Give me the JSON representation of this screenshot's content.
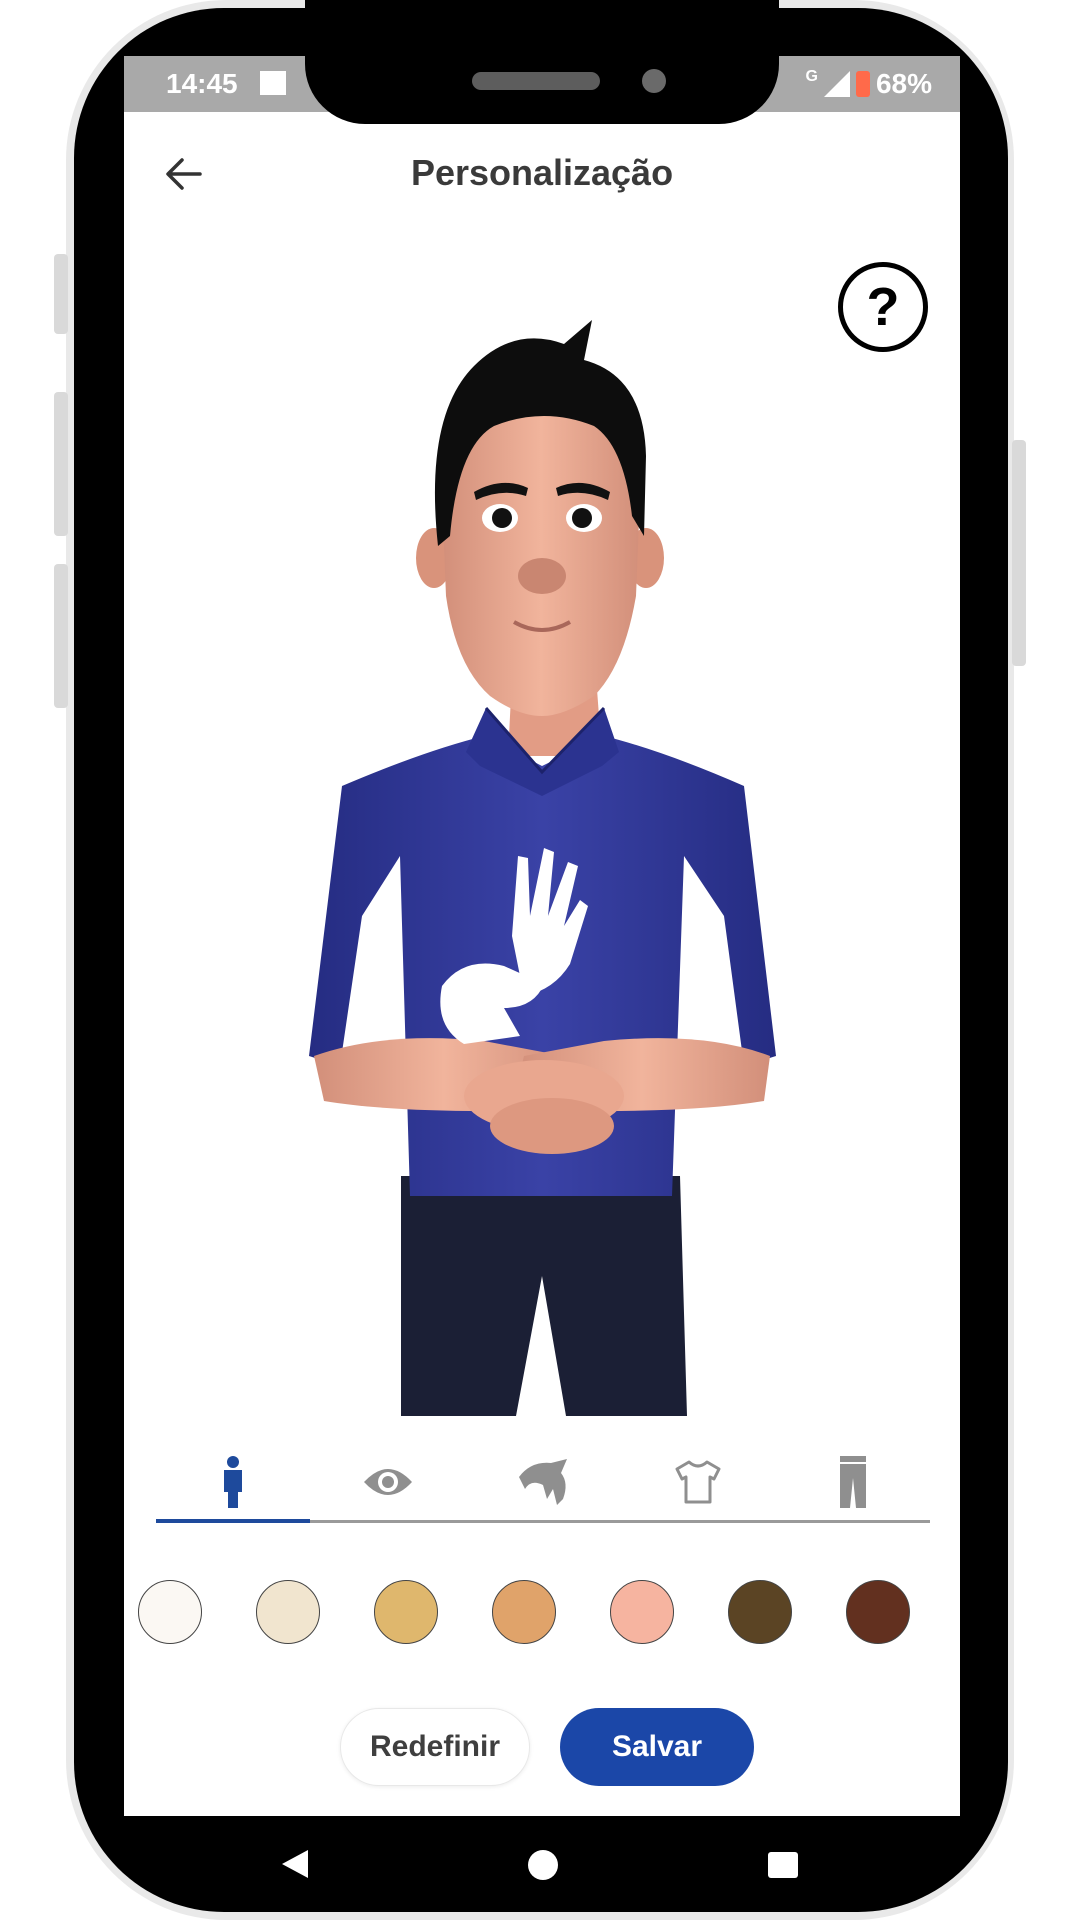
{
  "status_bar": {
    "time": "14:45",
    "network": "G",
    "battery": "68%",
    "icons": [
      "image-notification-icon",
      "signal-icon",
      "battery-icon"
    ]
  },
  "header": {
    "title": "Personalização",
    "back_icon": "arrow-left-icon"
  },
  "help": {
    "label": "?",
    "icon": "help-icon"
  },
  "tabs": [
    {
      "icon": "person-icon",
      "active": true,
      "color": "#1e4a9c"
    },
    {
      "icon": "eye-icon",
      "active": false,
      "color": "#8f8f8f"
    },
    {
      "icon": "hair-icon",
      "active": false,
      "color": "#8f8f8f"
    },
    {
      "icon": "shirt-icon",
      "active": false,
      "color": "#8f8f8f"
    },
    {
      "icon": "pants-icon",
      "active": false,
      "color": "#8f8f8f"
    }
  ],
  "skin_colors": [
    "#fbf8f3",
    "#f1e5cf",
    "#dfb76d",
    "#e0a36a",
    "#f6b4a0",
    "#5b4424",
    "#62301f"
  ],
  "actions": {
    "reset_label": "Redefinir",
    "save_label": "Salvar"
  },
  "colors": {
    "accent": "#1b47a8",
    "shirt": "#2d3592",
    "pants": "#1b1f35"
  }
}
